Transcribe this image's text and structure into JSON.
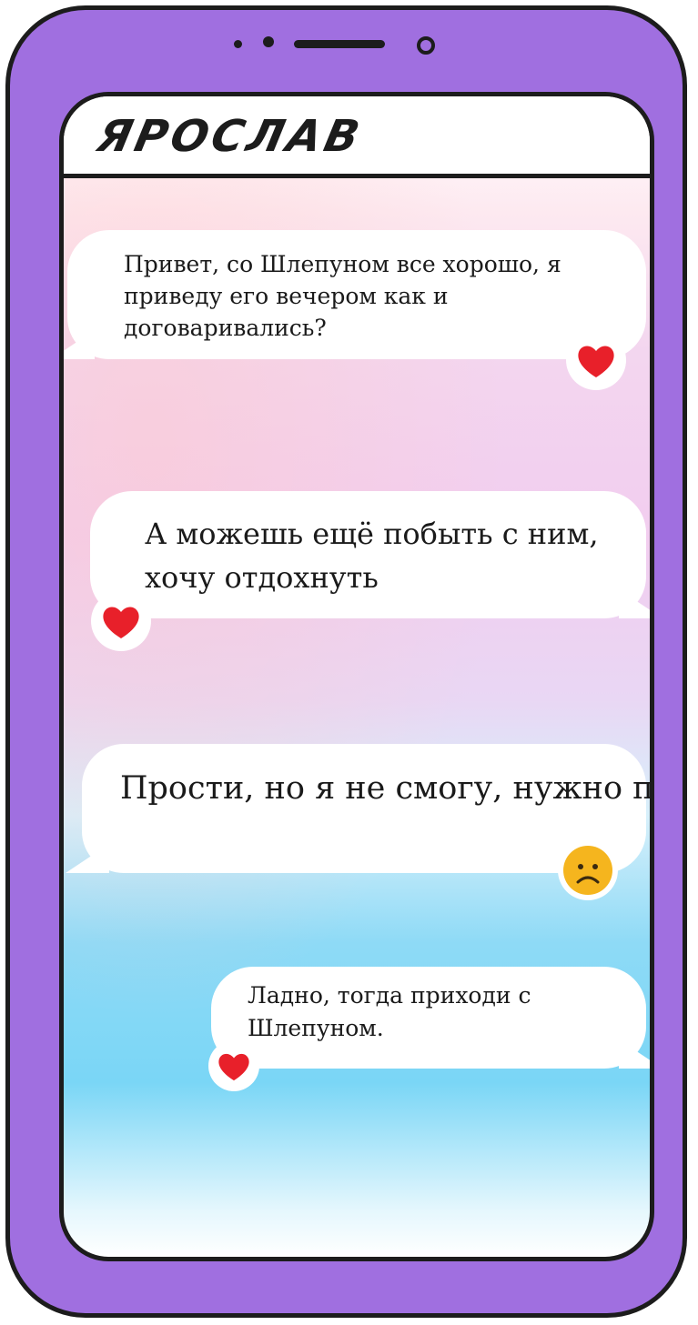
{
  "chat": {
    "contact_name": "ЯРОСЛАВ",
    "messages": [
      {
        "text": "Привет, со Шлепуном все хорошо, я приведу его вечером как и договаривались?",
        "reaction": "heart-icon"
      },
      {
        "text": "А можешь ещё побыть с ним, хочу отдохнуть",
        "reaction": "heart-icon"
      },
      {
        "text": "Прости, но я не смогу, нужно провести время с женой.",
        "reaction": "sad-face-icon"
      },
      {
        "text": "Ладно, тогда приходи с Шлепуном.",
        "reaction": "heart-icon"
      }
    ]
  },
  "colors": {
    "phone_body": "#a06fe0",
    "outline": "#1c1c1c",
    "heart": "#e8202a",
    "sad_face": "#f5b51e"
  }
}
